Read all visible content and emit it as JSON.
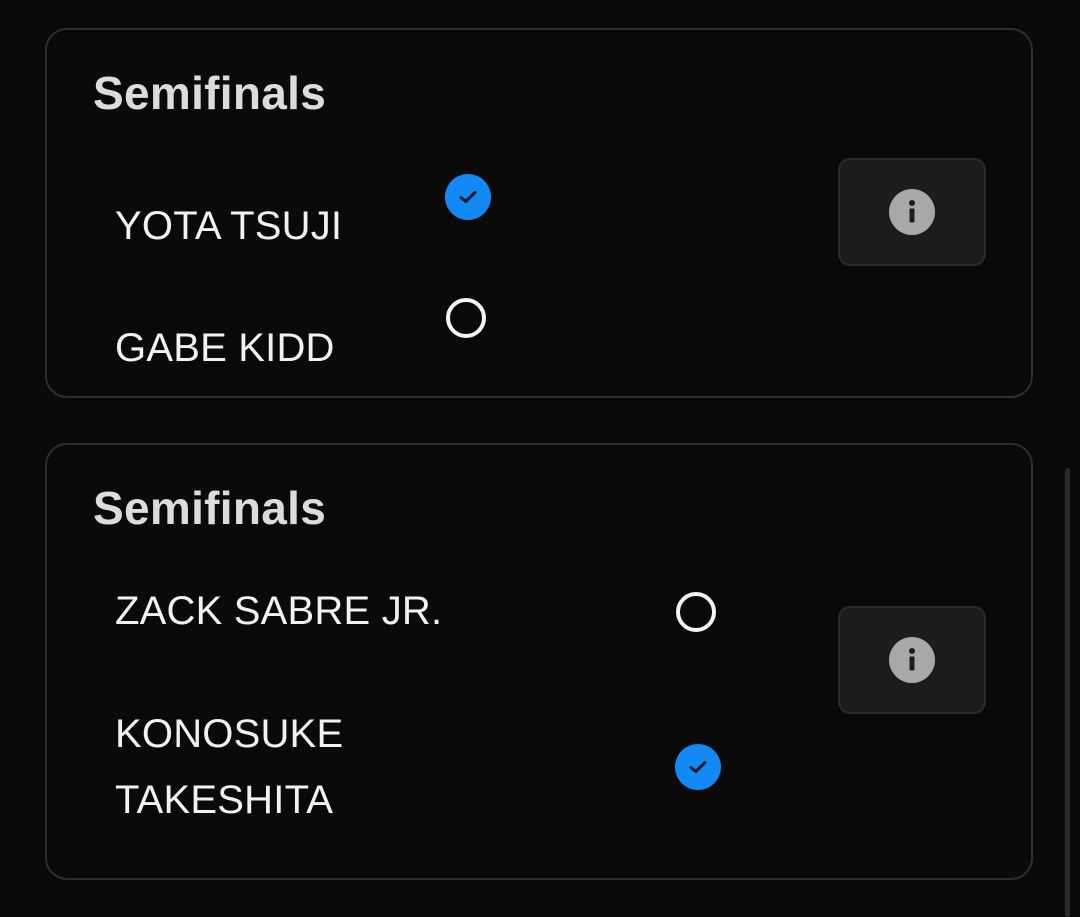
{
  "matches": [
    {
      "title": "Semifinals",
      "participants": [
        {
          "name": "YOTA TSUJI",
          "selected": true
        },
        {
          "name": "GABE KIDD",
          "selected": false
        }
      ],
      "info_icon": "info-icon"
    },
    {
      "title": "Semifinals",
      "participants": [
        {
          "name": "ZACK SABRE JR.",
          "selected": false
        },
        {
          "name": "KONOSUKE TAKESHITA",
          "name_line1": "KONOSUKE",
          "name_line2": "TAKESHITA",
          "selected": true
        }
      ],
      "info_icon": "info-icon"
    }
  ],
  "colors": {
    "background": "#0a0a0b",
    "card_border": "#2e2e31",
    "accent": "#1289f5",
    "title": "#dcdcdc",
    "text": "#f2f2f2",
    "info_button_bg": "#1c1c1e"
  }
}
